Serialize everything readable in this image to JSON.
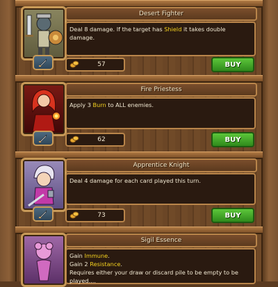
{
  "shop": {
    "items": [
      {
        "name": "Desert Fighter",
        "desc_before": "Deal 8 damage. If the target has ",
        "desc_keyword": "Shield",
        "desc_after": " it takes double damage.",
        "price": "57",
        "buy_label": "BUY",
        "type_icon": "sword-icon",
        "portrait_color": "#7a7452"
      },
      {
        "name": "Fire Priestess",
        "desc_before": "Apply 3 ",
        "desc_keyword": "Burn",
        "desc_after": " to ALL enemies.",
        "price": "62",
        "buy_label": "BUY",
        "type_icon": "sword-icon",
        "portrait_color": "#6a1414"
      },
      {
        "name": "Apprentice Knight",
        "desc_text": "Deal 4 damage for each card played this turn.",
        "price": "73",
        "buy_label": "BUY",
        "type_icon": "sword-icon",
        "portrait_color": "#7c6c9c"
      },
      {
        "name": "Sigil Essence",
        "line1_before": "Gain ",
        "line1_keyword": "Immune",
        "line1_after": ".",
        "line2_before": "Gain 2 ",
        "line2_keyword": "Resistance",
        "line2_after": ".",
        "line3": "Requires either your draw or discard pile to be empty to be played....",
        "portrait_color": "#8a4e8a"
      }
    ]
  },
  "colors": {
    "keyword": "#f4d11e",
    "buy_button": "#3fa82a",
    "panel": "#2a1a10",
    "frame": "#b9854a"
  }
}
